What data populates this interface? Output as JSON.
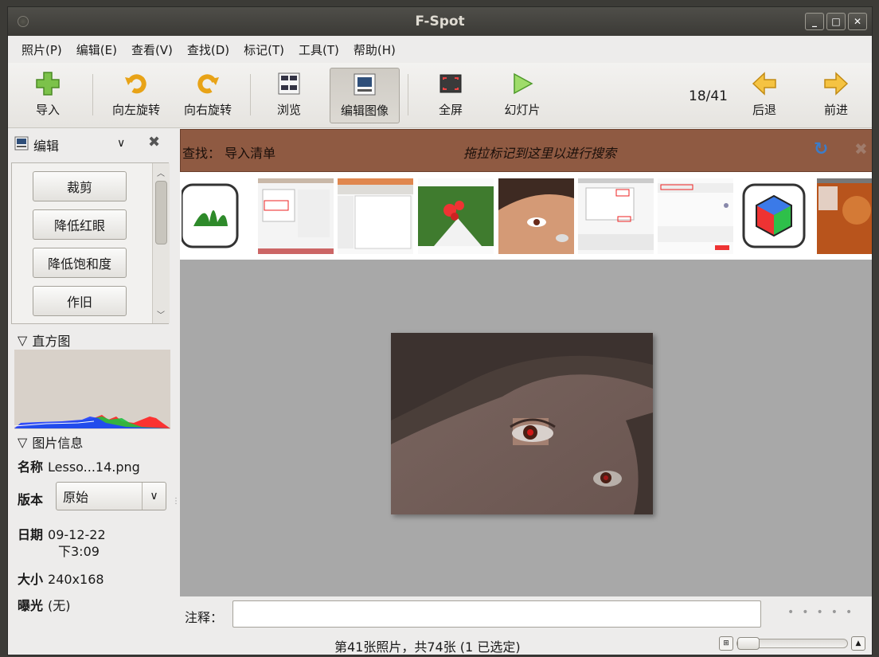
{
  "window": {
    "title": "F-Spot"
  },
  "menu": [
    {
      "label": "照片(P)"
    },
    {
      "label": "编辑(E)"
    },
    {
      "label": "查看(V)"
    },
    {
      "label": "查找(D)"
    },
    {
      "label": "标记(T)"
    },
    {
      "label": "工具(T)"
    },
    {
      "label": "帮助(H)"
    }
  ],
  "toolbar": {
    "import": "导入",
    "rotate_left": "向左旋转",
    "rotate_right": "向右旋转",
    "browse": "浏览",
    "edit_image": "编辑图像",
    "fullscreen": "全屏",
    "slideshow": "幻灯片",
    "counter": "18/41",
    "back": "后退",
    "forward": "前进"
  },
  "sidebar": {
    "title": "编辑",
    "edit_buttons": [
      "裁剪",
      "降低红眼",
      "降低饱和度",
      "作旧"
    ],
    "histogram_label": "直方图",
    "info_label": "图片信息",
    "info": {
      "name_label": "名称",
      "name_value": "Lesso...14.png",
      "version_label": "版本",
      "version_value": "原始",
      "date_label": "日期",
      "date_value": "09-12-22",
      "time_value": "下3:09",
      "size_label": "大小",
      "size_value": "240x168",
      "exposure_label": "曝光",
      "exposure_value": "(无)"
    }
  },
  "findbar": {
    "label": "查找： 导入清单",
    "hint": "拖拉标记到这里以进行搜索"
  },
  "comment": {
    "label": "注释：",
    "value": ""
  },
  "status": {
    "text": "第41张照片，共74张 (1 已选定)"
  },
  "colors": {
    "findbar_bg": "#8f5a42",
    "viewer_bg": "#a8a8a8",
    "titlebar": "#3c3b37"
  }
}
